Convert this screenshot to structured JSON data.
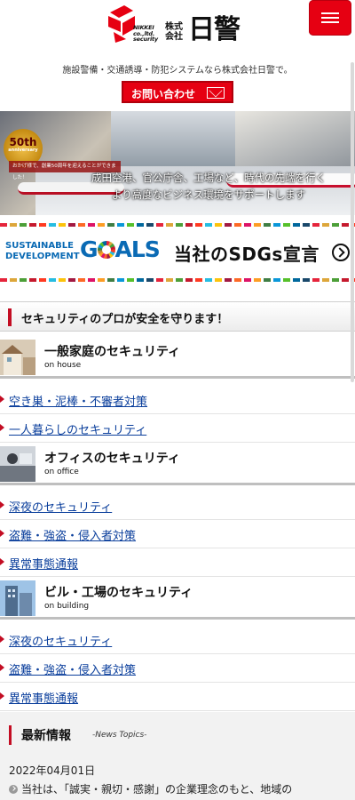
{
  "header": {
    "logo_en_line1": "NIKKEI",
    "logo_en_line2": "co.,ltd.",
    "logo_en_line3": "security",
    "logo_kk": "株式会社",
    "logo_name": "日警",
    "tagline": "施設警備・交通誘導・防犯システムなら株式会社日警で。",
    "contact_label": "お問い合わせ",
    "menu_icon": "hamburger-icon",
    "colors": {
      "accent": "#e60012",
      "link": "#0b3f9c"
    }
  },
  "hero": {
    "badge_number": "50th",
    "badge_small": "anniversary",
    "badge_ribbon": "おかげ様で、創業50周年を迎えることができました！",
    "line1": "成田空港、官公庁舎、工場など、時代の先端を行く",
    "line2": "より高度なビジネス環境をサポートします"
  },
  "sdgs": {
    "line1": "SUSTAINABLE",
    "line2": "DEVELOPMENT",
    "goals_pre": "G",
    "goals_post": "ALS",
    "declaration": "当社のSDGs宣言",
    "arrow_icon": "chevron-right-circle-icon"
  },
  "security": {
    "title": "セキュリティのプロが安全を守ります！",
    "categories": [
      {
        "title": "一般家庭のセキュリティ",
        "sub": "on house",
        "links": [
          "空き巣・泥棒・不審者対策",
          "一人暮らしのセキュリティ"
        ]
      },
      {
        "title": "オフィスのセキュリティ",
        "sub": "on office",
        "links": [
          "深夜のセキュリティ",
          "盗難・強盗・侵入者対策",
          "異常事態通報"
        ]
      },
      {
        "title": "ビル・工場のセキュリティ",
        "sub": "on building",
        "links": [
          "深夜のセキュリティ",
          "盗難・強盗・侵入者対策",
          "異常事態通報"
        ]
      }
    ]
  },
  "news": {
    "title": "最新情報",
    "subtitle": "-News Topics-",
    "items": [
      {
        "date": "2022年04月01日",
        "text": "当社は、「誠実・親切・感謝」の企業理念のもと、地域の"
      }
    ]
  }
}
